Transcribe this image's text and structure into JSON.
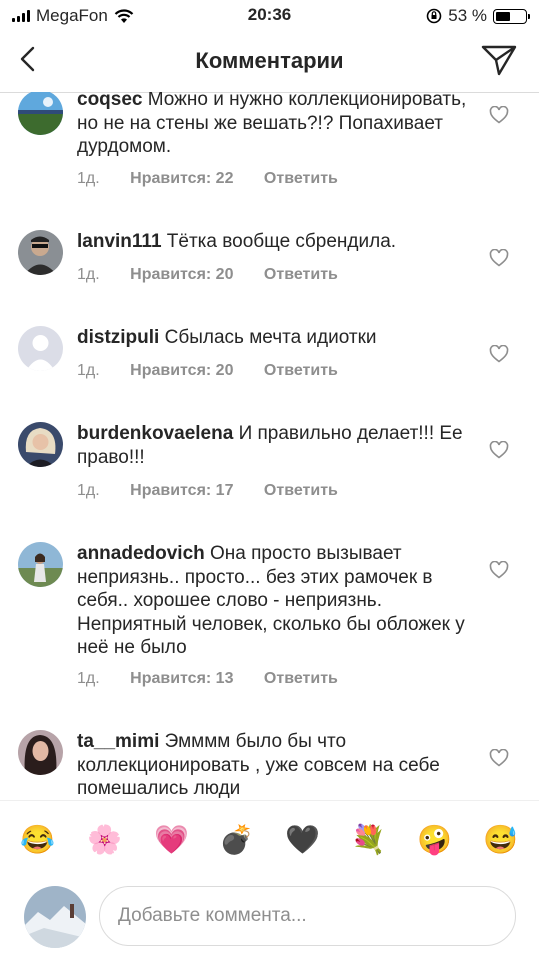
{
  "status_bar": {
    "carrier": "MegaFon",
    "time": "20:36",
    "battery_percent": "53 %",
    "battery_level": 0.53
  },
  "nav": {
    "title": "Комментарии"
  },
  "comments": [
    {
      "user": "coqsec",
      "text": "Можно и нужно коллекционировать, но не на стены же вешать?!? Попахивает дурдомом.",
      "time": "1д.",
      "likes": "Нравится: 22",
      "reply": "Ответить",
      "avatar_icon": "landscape-avatar"
    },
    {
      "user": "lanvin111",
      "text": "Тётка вообще сбрендила.",
      "time": "1д.",
      "likes": "Нравится: 20",
      "reply": "Ответить",
      "avatar_icon": "person-sunglasses-avatar"
    },
    {
      "user": "distzipuli",
      "text": "Сбылась мечта идиотки",
      "time": "1д.",
      "likes": "Нравится: 20",
      "reply": "Ответить",
      "avatar_icon": "default-avatar"
    },
    {
      "user": "burdenkovaelena",
      "text": "И правильно делает!!! Ее право!!!",
      "time": "1д.",
      "likes": "Нравится: 17",
      "reply": "Ответить",
      "avatar_icon": "blonde-woman-avatar"
    },
    {
      "user": "annadedovich",
      "text": "Она просто вызывает неприязнь.. просто... без этих рамочек в себя.. хорошее слово - неприязнь. Неприятный человек, сколько бы обложек у неё не было",
      "time": "1д.",
      "likes": "Нравится: 13",
      "reply": "Ответить",
      "avatar_icon": "woman-outdoors-avatar"
    },
    {
      "user": "ta__mimi",
      "text": "Эмммм было бы что коллекционировать , уже совсем на себе помешались люди",
      "time": "",
      "likes": "",
      "reply": "",
      "avatar_icon": "dark-hair-woman-avatar"
    }
  ],
  "emoji_bar": [
    "😂",
    "🌸",
    "💗",
    "💣",
    "🖤",
    "💐",
    "🤪",
    "😅"
  ],
  "input": {
    "placeholder": "Добавьте коммента..."
  },
  "colors": {
    "text": "#262626",
    "secondary": "#8e8e8e",
    "border": "#dbdbdb"
  }
}
